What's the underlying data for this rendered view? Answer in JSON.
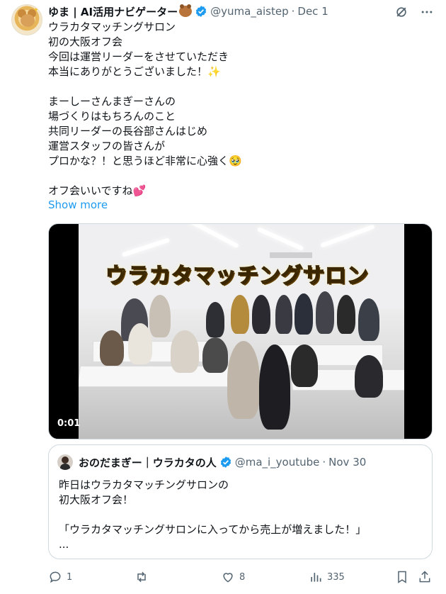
{
  "author": {
    "name": "ゆま | AI活用ナビゲーター",
    "handle": "@yuma_aistep",
    "date": "Dec 1"
  },
  "post": {
    "text": "ウラカタマッチングサロン\n初の大阪オフ会\n今回は運営リーダーをさせていただき\n本当にありがとうございました！✨\n\nまーしーさんまぎーさんの\n場づくりはもちろんのこと\n共同リーダーの長谷部さんはじめ\n運営スタッフの皆さんが\nプロかな？！と思うほど非常に心強く🥹\n\nオフ会いいですね💕",
    "show_more": "Show more"
  },
  "media": {
    "banner_text": "ウラカタマッチングサロン",
    "timecode": "0:01"
  },
  "quoted": {
    "name": "おのだまぎー｜ウラカタの人",
    "handle": "@ma_i_youtube",
    "date": "Nov 30",
    "text": "昨日はウラカタマッチングサロンの\n初大阪オフ会！\n\n「ウラカタマッチングサロンに入ってから売上が増えました！」\n..."
  },
  "actions": {
    "replies": "1",
    "reposts": "",
    "likes": "8",
    "views": "335"
  },
  "icons": [
    "verified-icon",
    "grok-icon",
    "more-icon",
    "reply-icon",
    "repost-icon",
    "like-icon",
    "views-icon",
    "bookmark-icon",
    "share-icon"
  ],
  "colors": {
    "accent": "#1d9bf0",
    "secondary_text": "#536471",
    "border": "#cfd9de"
  }
}
